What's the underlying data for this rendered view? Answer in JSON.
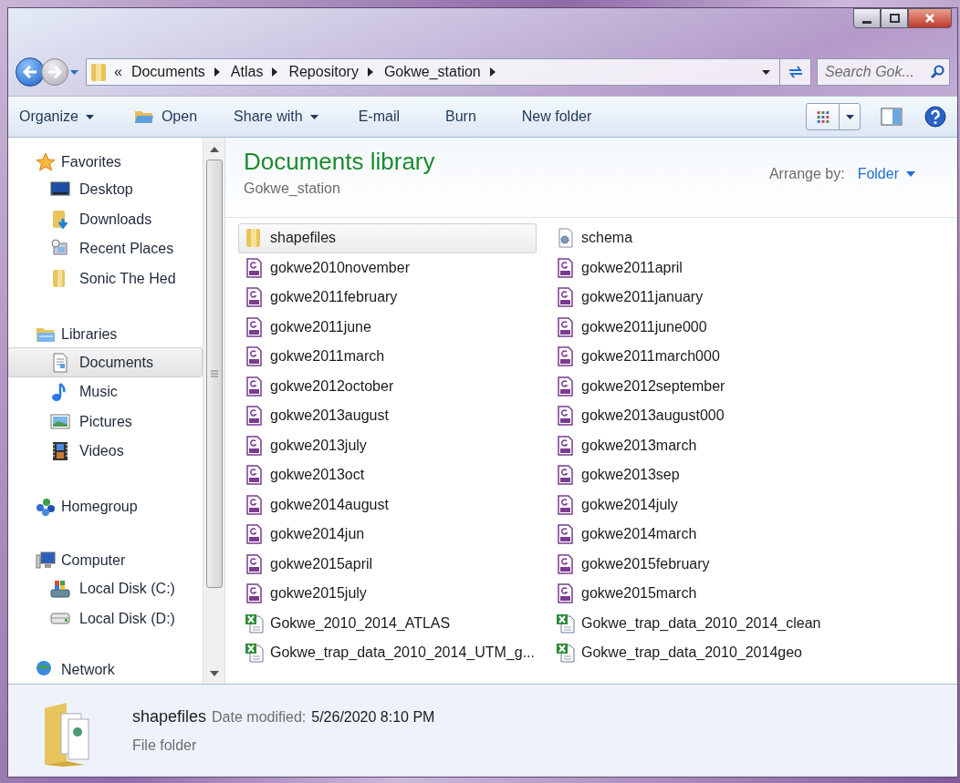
{
  "address_bar": {
    "crumbs": [
      "«",
      "Documents",
      "Atlas",
      "Repository",
      "Gokwe_station"
    ],
    "search_placeholder": "Search Gok..."
  },
  "toolbar": [
    {
      "label": "Organize",
      "dropdown": true,
      "icon": false
    },
    {
      "label": "Open",
      "dropdown": false,
      "icon": true
    },
    {
      "label": "Share with",
      "dropdown": true,
      "icon": false
    },
    {
      "label": "E-mail",
      "dropdown": false,
      "icon": false
    },
    {
      "label": "Burn",
      "dropdown": false,
      "icon": false
    },
    {
      "label": "New folder",
      "dropdown": false,
      "icon": false
    }
  ],
  "sidebar": {
    "groups": [
      {
        "label": "Favorites",
        "children": [
          {
            "label": "Desktop",
            "selected": false
          },
          {
            "label": "Downloads",
            "selected": false
          },
          {
            "label": "Recent Places",
            "selected": false
          },
          {
            "label": "Sonic The Hed",
            "selected": false
          }
        ]
      },
      {
        "label": "Libraries",
        "children": [
          {
            "label": "Documents",
            "selected": true
          },
          {
            "label": "Music",
            "selected": false
          },
          {
            "label": "Pictures",
            "selected": false
          },
          {
            "label": "Videos",
            "selected": false
          }
        ]
      },
      {
        "label": "Homegroup"
      },
      {
        "label": "Computer",
        "children": [
          {
            "label": "Local Disk (C:)",
            "selected": false
          },
          {
            "label": "Local Disk (D:)",
            "selected": false
          }
        ]
      },
      {
        "label": "Network"
      }
    ]
  },
  "content": {
    "title": "Documents library",
    "subtitle": "Gokwe_station",
    "arrange_label": "Arrange by:",
    "arrange_value": "Folder",
    "files": [
      {
        "name": "shapefiles",
        "kind": "folder",
        "selected": true
      },
      {
        "name": "schema",
        "kind": "config",
        "selected": false
      },
      {
        "name": "gokwe2010november",
        "kind": "pdf",
        "selected": false
      },
      {
        "name": "gokwe2011april",
        "kind": "pdf",
        "selected": false
      },
      {
        "name": "gokwe2011february",
        "kind": "pdf",
        "selected": false
      },
      {
        "name": "gokwe2011january",
        "kind": "pdf",
        "selected": false
      },
      {
        "name": "gokwe2011june",
        "kind": "pdf",
        "selected": false
      },
      {
        "name": "gokwe2011june000",
        "kind": "pdf",
        "selected": false
      },
      {
        "name": "gokwe2011march",
        "kind": "pdf",
        "selected": false
      },
      {
        "name": "gokwe2011march000",
        "kind": "pdf",
        "selected": false
      },
      {
        "name": "gokwe2012october",
        "kind": "pdf",
        "selected": false
      },
      {
        "name": "gokwe2012september",
        "kind": "pdf",
        "selected": false
      },
      {
        "name": "gokwe2013august",
        "kind": "pdf",
        "selected": false
      },
      {
        "name": "gokwe2013august000",
        "kind": "pdf",
        "selected": false
      },
      {
        "name": "gokwe2013july",
        "kind": "pdf",
        "selected": false
      },
      {
        "name": "gokwe2013march",
        "kind": "pdf",
        "selected": false
      },
      {
        "name": "gokwe2013oct",
        "kind": "pdf",
        "selected": false
      },
      {
        "name": "gokwe2013sep",
        "kind": "pdf",
        "selected": false
      },
      {
        "name": "gokwe2014august",
        "kind": "pdf",
        "selected": false
      },
      {
        "name": "gokwe2014july",
        "kind": "pdf",
        "selected": false
      },
      {
        "name": "gokwe2014jun",
        "kind": "pdf",
        "selected": false
      },
      {
        "name": "gokwe2014march",
        "kind": "pdf",
        "selected": false
      },
      {
        "name": "gokwe2015april",
        "kind": "pdf",
        "selected": false
      },
      {
        "name": "gokwe2015february",
        "kind": "pdf",
        "selected": false
      },
      {
        "name": "gokwe2015july",
        "kind": "pdf",
        "selected": false
      },
      {
        "name": "gokwe2015march",
        "kind": "pdf",
        "selected": false
      },
      {
        "name": "Gokwe_2010_2014_ATLAS",
        "kind": "excel",
        "selected": false
      },
      {
        "name": "Gokwe_trap_data_2010_2014_clean",
        "kind": "excel",
        "selected": false
      },
      {
        "name": "Gokwe_trap_data_2010_2014_UTM_g...",
        "kind": "excel",
        "selected": false
      },
      {
        "name": "Gokwe_trap_data_2010_2014geo",
        "kind": "excel",
        "selected": false
      }
    ]
  },
  "details": {
    "name": "shapefiles",
    "date_label": "Date modified:",
    "date_value": "5/26/2020 8:10 PM",
    "type": "File folder"
  }
}
